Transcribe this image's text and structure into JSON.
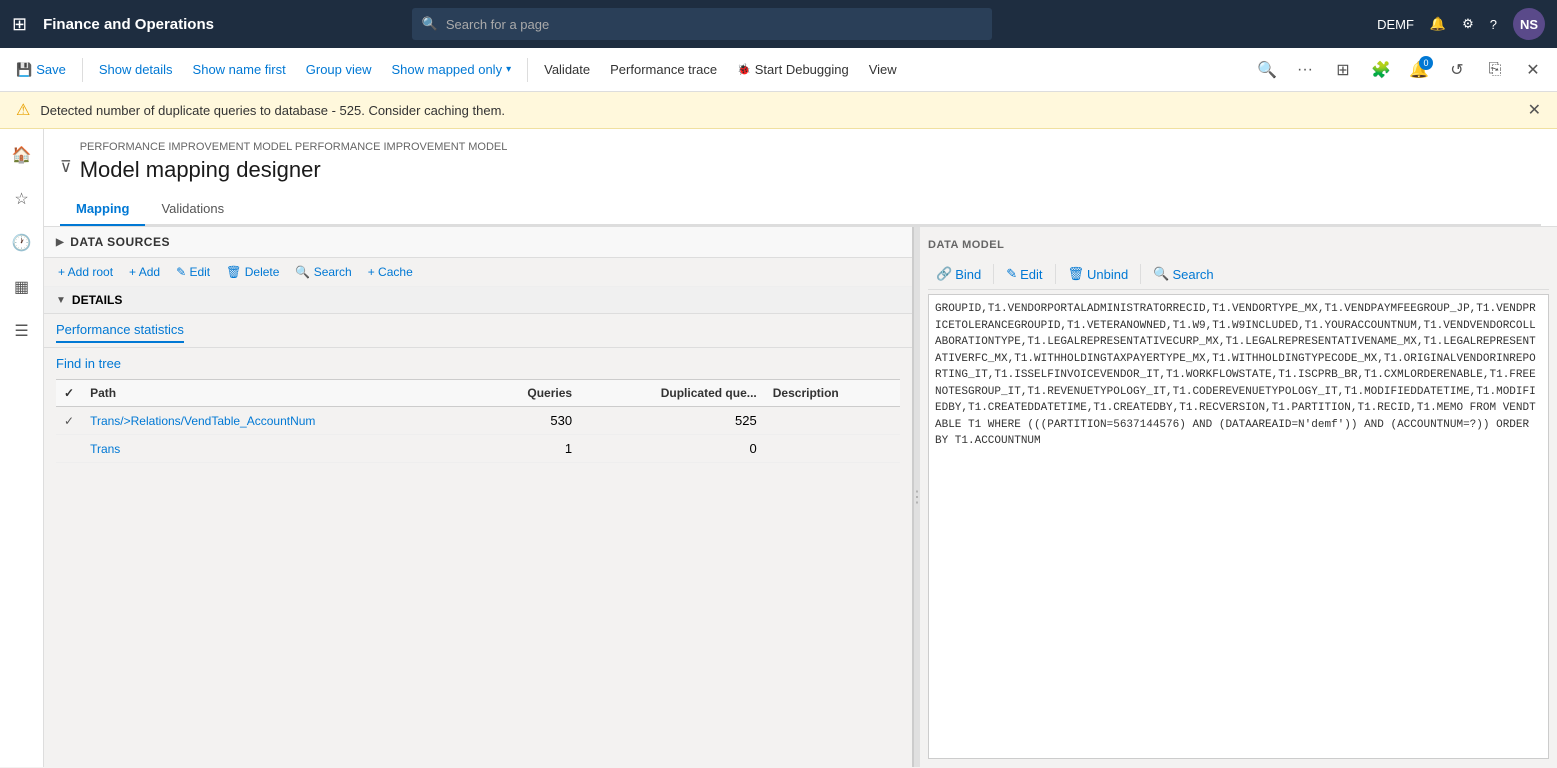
{
  "topbar": {
    "title": "Finance and Operations",
    "search_placeholder": "Search for a page",
    "user": "DEMF",
    "avatar": "NS"
  },
  "toolbar": {
    "save_label": "Save",
    "show_details_label": "Show details",
    "show_name_first_label": "Show name first",
    "group_view_label": "Group view",
    "show_mapped_only_label": "Show mapped only",
    "validate_label": "Validate",
    "performance_trace_label": "Performance trace",
    "start_debugging_label": "Start Debugging",
    "view_label": "View",
    "badge_count": "0"
  },
  "warning": {
    "text": "Detected number of duplicate queries to database - 525. Consider caching them."
  },
  "page": {
    "breadcrumb": "PERFORMANCE IMPROVEMENT MODEL PERFORMANCE IMPROVEMENT MODEL",
    "title": "Model mapping designer"
  },
  "tabs": [
    {
      "label": "Mapping",
      "active": true
    },
    {
      "label": "Validations",
      "active": false
    }
  ],
  "data_sources": {
    "header": "DATA SOURCES",
    "toolbar_buttons": [
      {
        "label": "+ Add root"
      },
      {
        "label": "+ Add"
      },
      {
        "label": "✎ Edit"
      },
      {
        "label": "🗑 Delete"
      },
      {
        "label": "🔍 Search"
      },
      {
        "label": "+ Cache"
      }
    ]
  },
  "details": {
    "header": "DETAILS",
    "tab": "Performance statistics",
    "find_link": "Find in tree"
  },
  "table": {
    "columns": [
      "",
      "Path",
      "Queries",
      "Duplicated que...",
      "Description"
    ],
    "rows": [
      {
        "checked": true,
        "path": "Trans/>Relations/VendTable_AccountNum",
        "queries": "530",
        "duplicated": "525",
        "description": ""
      },
      {
        "checked": false,
        "path": "Trans",
        "queries": "1",
        "duplicated": "0",
        "description": ""
      }
    ]
  },
  "data_model": {
    "header": "DATA MODEL",
    "buttons": [
      {
        "label": "Bind",
        "icon": "🔗"
      },
      {
        "label": "Edit",
        "icon": "✎"
      },
      {
        "label": "Unbind",
        "icon": "🗑"
      },
      {
        "label": "Search",
        "icon": "🔍"
      }
    ]
  },
  "sql_content": "GROUPID,T1.VENDORPORTALADMINISTRATORRECID,T1.VENDORTYPE_MX,T1.VENDPAYMFEEGROUP_JP,T1.VENDPRICETOLERANCEGROUPID,T1.VETERANOWNED,T1.W9,T1.W9INCLUDED,T1.YOURACCOUNTNUM,T1.VENDVENDORCOLLABORATIONTYPE,T1.LEGALREPRESENTATIVECURP_MX,T1.LEGALREPRESENTATIVENAME_MX,T1.LEGALREPRESENTATIVERFC_MX,T1.WITHHOLDINGTAXPAYERTYPE_MX,T1.WITHHOLDINGTYPECODE_MX,T1.ORIGINALVENDORINREPORTING_IT,T1.ISSELFINVOICEVENDOR_IT,T1.WORKFLOWSTATE,T1.ISCPRB_BR,T1.CXMLORDERENABLE,T1.FREENOTESGROUP_IT,T1.REVENUETYPOLOGY_IT,T1.CODEREVENUETYPOLOGY_IT,T1.MODIFIEDDATETIME,T1.MODIFIEDBY,T1.CREATEDDATETIME,T1.CREATEDBY,T1.RECVERSION,T1.PARTITION,T1.RECID,T1.MEMO FROM VENDTABLE T1 WHERE (((PARTITION=5637144576) AND (DATAAREAID=N'demf')) AND (ACCOUNTNUM=?)) ORDER BY T1.ACCOUNTNUM"
}
